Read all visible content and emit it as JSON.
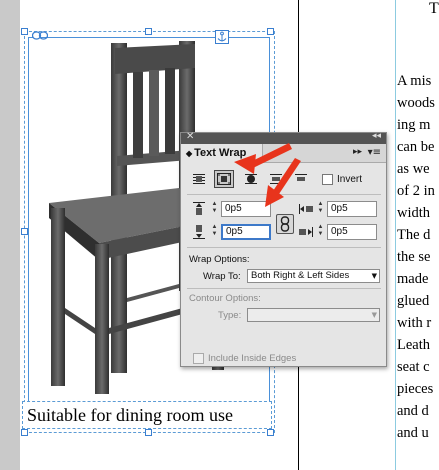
{
  "document": {
    "caption": "Suitable for dining room use",
    "top_char": "T",
    "body_lines": [
      "A mis",
      "woods",
      "ing m",
      "can be",
      "as we",
      "of 2 in",
      "width",
      "The d",
      "the se",
      "made",
      "glued",
      "with r",
      "Leath",
      "seat c",
      "pieces",
      "and d",
      "and u"
    ]
  },
  "panel": {
    "title": "Text Wrap",
    "close_glyph": "✕",
    "collapse_glyph": "◂◂",
    "menu_glyph": "▾≡",
    "expand_glyph": "▸▸",
    "tab_arrows": "◆",
    "wrap_modes": [
      {
        "name": "no-wrap",
        "icon": "wrap-none-icon",
        "active": false
      },
      {
        "name": "wrap-bounding-box",
        "icon": "wrap-bounding-box-icon",
        "active": true
      },
      {
        "name": "wrap-object-shape",
        "icon": "wrap-object-shape-icon",
        "active": false
      },
      {
        "name": "jump-object",
        "icon": "jump-object-icon",
        "active": false
      },
      {
        "name": "jump-next-column",
        "icon": "jump-next-column-icon",
        "active": false
      }
    ],
    "invert_label": "Invert",
    "invert_checked": false,
    "offsets": {
      "top": "0p5",
      "bottom": "0p5",
      "left": "0p5",
      "right": "0p5"
    },
    "wrap_options_label": "Wrap Options:",
    "wrap_to_label": "Wrap To:",
    "wrap_to_value": "Both Right & Left Sides",
    "contour_options_label": "Contour Options:",
    "type_label": "Type:",
    "type_value": "",
    "include_inside_edges_label": "Include Inside Edges",
    "include_inside_edges_checked": false
  },
  "colors": {
    "callout_arrow": "#e8341c",
    "selection_frame": "#4a90d9",
    "column_guide": "#8ccbe0",
    "panel_bg": "#e5e5e5",
    "panel_titlebar": "#545454"
  }
}
